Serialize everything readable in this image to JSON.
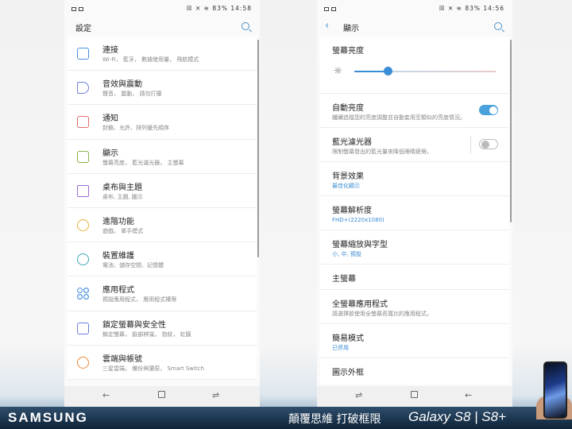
{
  "left_screen": {
    "status": {
      "icons": "☒ ✕ ≋",
      "battery": "83%",
      "time": "14:58"
    },
    "title": "設定",
    "search_icon": "search-icon",
    "items": [
      {
        "title": "連接",
        "subtitle": "Wi-Fi， 藍牙， 數據使用量， 飛航模式",
        "icon": "connections-icon"
      },
      {
        "title": "音效與震動",
        "subtitle": "聲音， 震動， 請勿打擾",
        "icon": "sound-icon"
      },
      {
        "title": "通知",
        "subtitle": "封鎖、允許、排列優先順序",
        "icon": "notifications-icon"
      },
      {
        "title": "顯示",
        "subtitle": "螢幕亮度， 藍光濾光器， 主螢幕",
        "icon": "display-icon"
      },
      {
        "title": "桌布與主題",
        "subtitle": "桌布, 主題, 圖示",
        "icon": "wallpaper-icon"
      },
      {
        "title": "進階功能",
        "subtitle": "遊戲， 單手模式",
        "icon": "advanced-icon"
      },
      {
        "title": "裝置維護",
        "subtitle": "電池、儲存空間、記憶體",
        "icon": "maintenance-icon"
      },
      {
        "title": "應用程式",
        "subtitle": "預設應用程式， 應用程式權限",
        "icon": "apps-icon"
      },
      {
        "title": "鎖定螢幕與安全性",
        "subtitle": "鎖定螢幕， 臉部辨識， 指紋， 虹膜",
        "icon": "lock-icon"
      },
      {
        "title": "雲端與帳號",
        "subtitle": "三星雲端， 備份與還原， Smart Switch",
        "icon": "cloud-icon"
      }
    ]
  },
  "right_screen": {
    "status": {
      "icons": "☒ ✕ ≋",
      "battery": "83%",
      "time": "14:56"
    },
    "title": "顯示",
    "brightness": {
      "title": "螢幕亮度",
      "level": 0.24
    },
    "auto_brightness": {
      "title": "自動亮度",
      "subtitle": "纖續追蹤您的亮度調整並自動套用至類似的亮度情況。",
      "on": true
    },
    "blue_light": {
      "title": "藍光濾光器",
      "subtitle": "限制螢幕發出的藍光量來降低眼睛疲勞。",
      "on": false
    },
    "items": [
      {
        "title": "背景效果",
        "subtitle": "最佳化顯示",
        "blue": true
      },
      {
        "title": "螢幕解析度",
        "subtitle": "FHD+(2220x1080)",
        "blue": true
      },
      {
        "title": "螢幕縮放與字型",
        "subtitle": "小, 中, 預設",
        "blue": true
      },
      {
        "title": "主螢幕",
        "subtitle": "",
        "blue": false
      },
      {
        "title": "全螢幕應用程式",
        "subtitle": "請選擇欲使用全螢幕長寬比的應用程式。",
        "blue": false
      },
      {
        "title": "簡易模式",
        "subtitle": "已停用",
        "blue": true
      },
      {
        "title": "圖示外框",
        "subtitle": "",
        "blue": false
      }
    ]
  },
  "navbar": {
    "back": "←",
    "recents": "⇌"
  },
  "banner": {
    "brand": "SAMSUNG",
    "slogan": "顛覆思維 打破框限",
    "model": "Galaxy S8 | S8+"
  }
}
